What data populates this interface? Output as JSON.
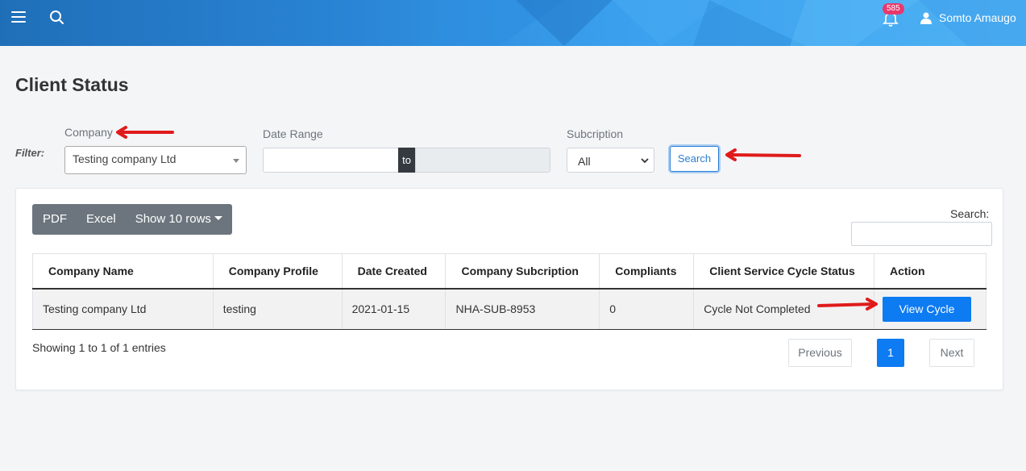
{
  "header": {
    "notification_count": "585",
    "user_name": "Somto Amaugo"
  },
  "page": {
    "title": "Client Status"
  },
  "filter": {
    "label": "Filter:",
    "company_label": "Company",
    "company_value": "Testing company Ltd",
    "date_range_label": "Date Range",
    "date_to": "to",
    "subscription_label": "Subcription",
    "subscription_value": "All",
    "search_button": "Search"
  },
  "toolbar": {
    "pdf": "PDF",
    "excel": "Excel",
    "show_rows": "Show 10 rows"
  },
  "table_search": {
    "label": "Search:"
  },
  "table": {
    "columns": [
      "Company Name",
      "Company Profile",
      "Date Created",
      "Company Subcription",
      "Compliants",
      "Client Service Cycle Status",
      "Action"
    ],
    "rows": [
      {
        "company_name": "Testing company Ltd",
        "company_profile": "testing",
        "date_created": "2021-01-15",
        "subscription": "NHA-SUB-8953",
        "complaints": "0",
        "status": "Cycle Not Completed",
        "action": "View Cycle"
      }
    ]
  },
  "footer": {
    "info": "Showing 1 to 1 of 1 entries",
    "previous": "Previous",
    "current_page": "1",
    "next": "Next"
  },
  "colors": {
    "accent": "#0d7bf2",
    "annotation_arrow": "#e01b1b",
    "badge": "#e8386d"
  }
}
